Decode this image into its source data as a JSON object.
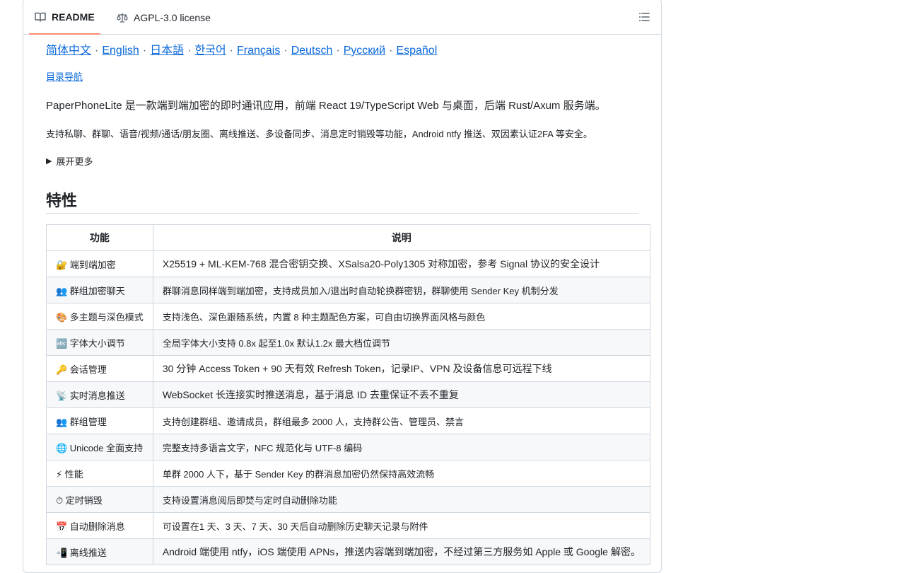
{
  "tabs": {
    "readme": "README",
    "license": "AGPL-3.0 license"
  },
  "languages": [
    "简体中文",
    "English",
    "日本語",
    "한국어",
    "Français",
    "Deutsch",
    "Русский",
    "Español"
  ],
  "lang_sep": "·",
  "readme": {
    "toc_link": "目录导航",
    "intro": "PaperPhoneLite 是一款端到端加密的即时通讯应用，前端 React 19/TypeScript Web 与桌面，后端 Rust/Axum 服务端。",
    "summary": "支持私聊、群聊、语音/视频/通话/朋友圈、离线推送、多设备同步、消息定时销毁等功能，Android ntfy 推送、双因素认证2FA 等安全。",
    "details_label": "展开更多",
    "features_heading": "特性"
  },
  "features_table": {
    "headers": [
      "功能",
      "说明"
    ],
    "rows": [
      [
        "🔐 端到端加密",
        "X25519 + ML-KEM-768 混合密钥交换、XSalsa20-Poly1305 对称加密，参考 Signal 协议的安全设计"
      ],
      [
        "👥 群组加密聊天",
        "群聊消息同样端到端加密，支持成员加入/退出时自动轮换群密钥，群聊使用 Sender Key 机制分发"
      ],
      [
        "🎨 多主题与深色模式",
        "支持浅色、深色跟随系统，内置 8 种主题配色方案，可自由切换界面风格与颜色"
      ],
      [
        "🔤 字体大小调节",
        "全局字体大小支持 0.8x 起至1.0x 默认1.2x 最大档位调节"
      ],
      [
        "🔑 会话管理",
        "30 分钟 Access Token + 90 天有效 Refresh Token，记录IP、VPN 及设备信息可远程下线"
      ],
      [
        "📡 实时消息推送",
        "WebSocket 长连接实时推送消息，基于消息 ID 去重保证不丢不重复"
      ],
      [
        "👥 群组管理",
        "支持创建群组、邀请成员，群组最多 2000 人，支持群公告、管理员、禁言"
      ],
      [
        "🌐 Unicode 全面支持",
        "完整支持多语言文字，NFC 规范化与 UTF-8 编码"
      ],
      [
        "⚡ 性能",
        "单群 2000 人下，基于 Sender Key 的群消息加密仍然保持高效流畅"
      ],
      [
        "⏱ 定时销毁",
        "支持设置消息阅后即焚与定时自动删除功能"
      ],
      [
        "📅 自动删除消息",
        "可设置在1 天、3 天、7 天、30 天后自动删除历史聊天记录与附件"
      ],
      [
        "📲 离线推送",
        "Android 端使用 ntfy，iOS 端使用 APNs，推送内容端到端加密，不经过第三方服务如 Apple 或 Google 解密。"
      ]
    ]
  }
}
